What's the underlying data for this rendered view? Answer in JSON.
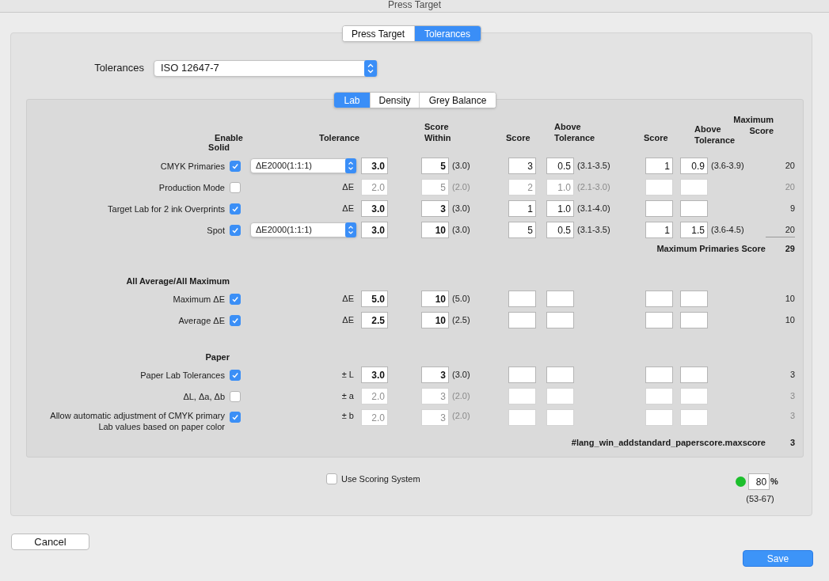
{
  "window": {
    "title": "Press Target"
  },
  "tabs": [
    {
      "label": "Press Target",
      "selected": false
    },
    {
      "label": "Tolerances",
      "selected": true
    }
  ],
  "tolerances": {
    "label": "Tolerances",
    "value": "ISO 12647-7"
  },
  "subtabs": [
    {
      "label": "Lab",
      "selected": true
    },
    {
      "label": "Density",
      "selected": false
    },
    {
      "label": "Grey Balance",
      "selected": false
    }
  ],
  "columns": [
    "Enable",
    "Tolerance",
    "Score Within",
    "Score",
    "Above Tolerance",
    "Score",
    "Above Tolerance",
    "Maximum Score"
  ],
  "sections": [
    {
      "heading": "Solid",
      "rows": [
        {
          "label": "CMYK Primaries",
          "checked": true,
          "disabled": false,
          "method": {
            "kind": "dropdown",
            "value": "ΔE2000(1:1:1)"
          },
          "tolerance": "3.0",
          "score_within": "5",
          "within_range": "(3.0)",
          "score": "3",
          "above": "0.5",
          "above_range": "(3.1-3.5)",
          "score2": "1",
          "above2": "0.9",
          "above2_range": "(3.6-3.9)",
          "max_score": "20"
        },
        {
          "label": "Production Mode",
          "checked": false,
          "disabled": true,
          "method": {
            "kind": "unit",
            "value": "ΔE"
          },
          "tolerance": "2.0",
          "score_within": "5",
          "within_range": "(2.0)",
          "score": "2",
          "above": "1.0",
          "above_range": "(2.1-3.0)",
          "max_score": "20"
        },
        {
          "label": "Target Lab for 2 ink Overprints",
          "checked": true,
          "disabled": false,
          "method": {
            "kind": "unit",
            "value": "ΔE"
          },
          "tolerance": "3.0",
          "score_within": "3",
          "within_range": "(3.0)",
          "score": "1",
          "above": "1.0",
          "above_range": "(3.1-4.0)",
          "max_score": "9"
        },
        {
          "label": "Spot",
          "checked": true,
          "disabled": false,
          "method": {
            "kind": "dropdown",
            "value": "ΔE2000(1:1:1)"
          },
          "tolerance": "3.0",
          "score_within": "10",
          "within_range": "(3.0)",
          "score": "5",
          "above": "0.5",
          "above_range": "(3.1-3.5)",
          "score2": "1",
          "above2": "1.5",
          "above2_range": "(3.6-4.5)",
          "max_score": "20"
        }
      ],
      "footer": {
        "label": "Maximum Primaries Score",
        "value": "29"
      }
    },
    {
      "heading": "All Average/All Maximum",
      "rows": [
        {
          "label": "Maximum ΔE",
          "checked": true,
          "disabled": false,
          "method": {
            "kind": "unit",
            "value": "ΔE"
          },
          "tolerance": "5.0",
          "score_within": "10",
          "within_range": "(5.0)",
          "max_score": "10"
        },
        {
          "label": "Average ΔE",
          "checked": true,
          "disabled": false,
          "method": {
            "kind": "unit",
            "value": "ΔE"
          },
          "tolerance": "2.5",
          "score_within": "10",
          "within_range": "(2.5)",
          "max_score": "10"
        }
      ]
    },
    {
      "heading": "Paper",
      "rows": [
        {
          "label": "Paper Lab Tolerances",
          "checked": true,
          "disabled": false,
          "method": {
            "kind": "unit",
            "value": "± L"
          },
          "tolerance": "3.0",
          "score_within": "3",
          "within_range": "(3.0)",
          "max_score": "3"
        },
        {
          "label": "ΔL, Δa, Δb",
          "checked": false,
          "disabled": true,
          "method": {
            "kind": "unit",
            "value": "± a"
          },
          "tolerance": "2.0",
          "score_within": "3",
          "within_range": "(2.0)",
          "max_score": "3"
        },
        {
          "label": "Allow automatic adjustment of CMYK primary Lab values based on paper color",
          "checked": true,
          "disabled": true,
          "method": {
            "kind": "unit",
            "value": "± b"
          },
          "tolerance": "2.0",
          "score_within": "3",
          "within_range": "(2.0)",
          "max_score": "3"
        }
      ],
      "footer": {
        "label": "#lang_win_addstandard_paperscore.maxscore",
        "value": "3"
      }
    }
  ],
  "scoring": {
    "label": "Use Scoring System",
    "checked": false
  },
  "result": {
    "color": "#1cbf2c",
    "value": "80",
    "unit": "%",
    "range": "(53-67)"
  },
  "buttons": [
    {
      "label": "Cancel",
      "kind": "default"
    },
    {
      "label": "Save",
      "kind": "primary"
    }
  ]
}
